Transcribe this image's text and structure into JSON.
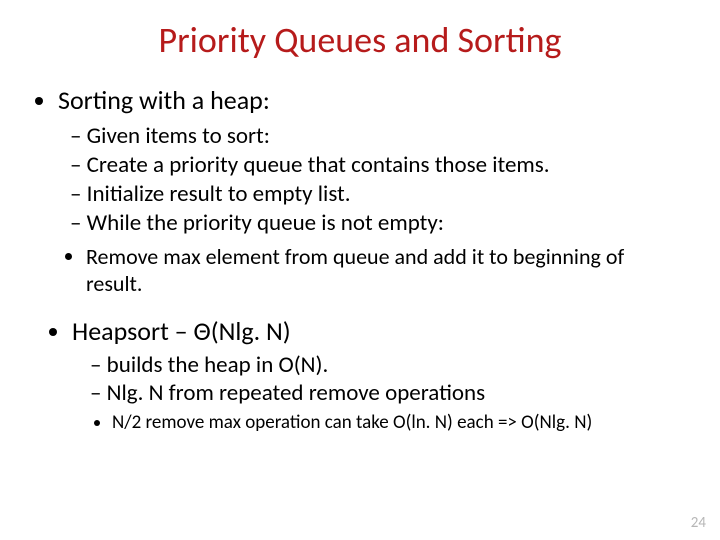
{
  "title": "Priority Queues and Sorting",
  "bullets": {
    "l1a": "Sorting with a heap:",
    "l2": [
      "Given items to sort:",
      "Create a priority queue that contains those items.",
      "Initialize result to empty list.",
      "While the priority queue is not empty:"
    ],
    "l3a": "Remove max element from queue and add it to beginning of result.",
    "l1b": "Heapsort – Θ(Nlg. N)",
    "l2b": [
      "builds the heap in O(N).",
      "Nlg. N from repeated remove operations"
    ],
    "l3b": "N/2 remove max operation can take O(ln. N) each => O(Nlg. N)"
  },
  "page_number": "24"
}
